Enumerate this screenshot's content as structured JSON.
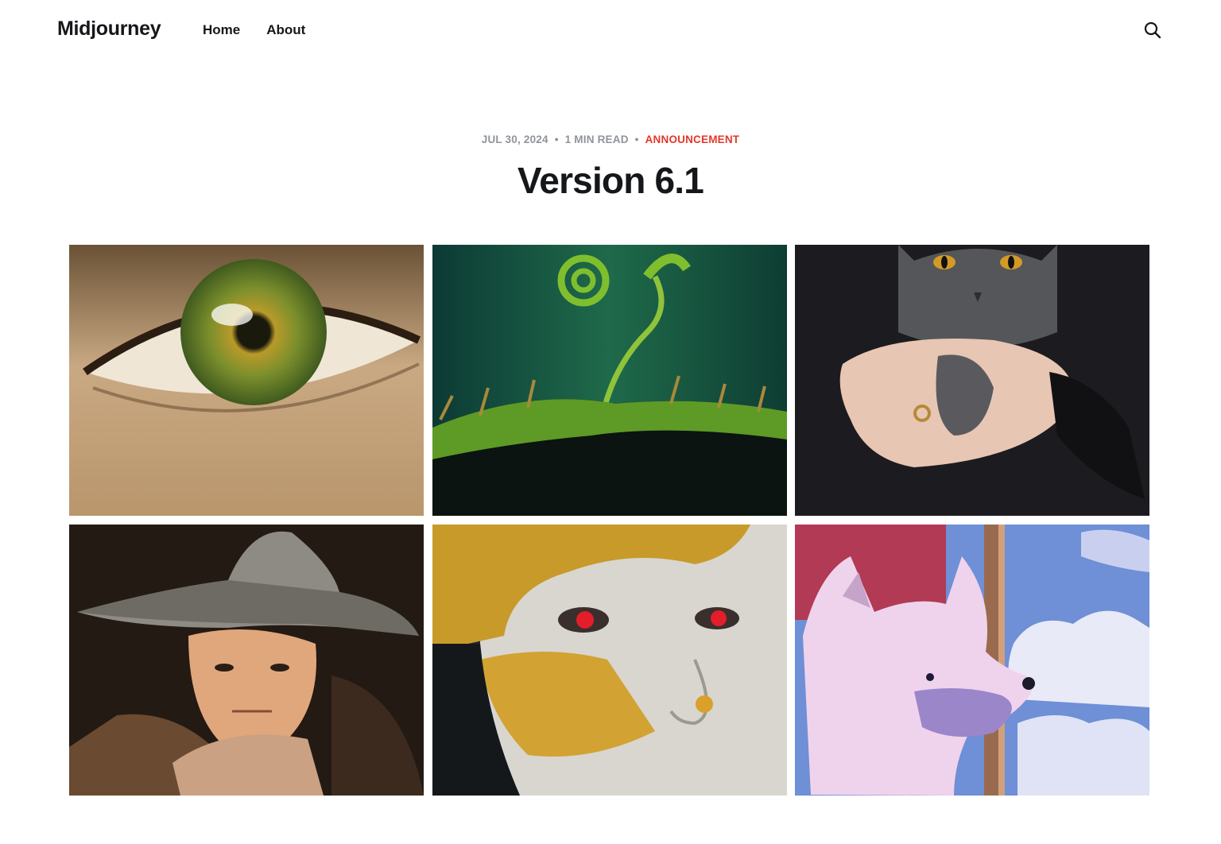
{
  "site": {
    "logo": "Midjourney",
    "nav": [
      "Home",
      "About"
    ]
  },
  "header_icons": {
    "search": "search-icon"
  },
  "post": {
    "date": "JUL 30, 2024",
    "read_time": "1 MIN READ",
    "tag": "ANNOUNCEMENT",
    "title": "Version 6.1",
    "colors": {
      "tag": "#e3382c",
      "meta": "#8f949a",
      "text": "#15171a"
    }
  },
  "gallery": [
    {
      "subject": "close-up green eye"
    },
    {
      "subject": "fern fiddlehead over moss"
    },
    {
      "subject": "grey cat held in hands"
    },
    {
      "subject": "figure in weathered hat"
    },
    {
      "subject": "face with gold leaf and red eyes"
    },
    {
      "subject": "pixel-art white wolf with clouds"
    }
  ]
}
